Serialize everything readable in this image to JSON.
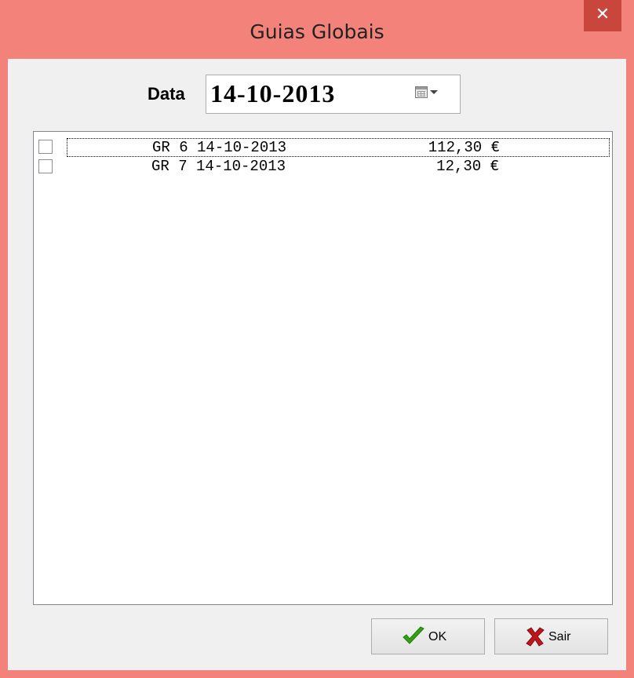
{
  "window": {
    "title": "Guias Globais",
    "close_glyph": "✕"
  },
  "date": {
    "label": "Data",
    "value": "14-10-2013",
    "picker_icon": "calendar-icon"
  },
  "list": {
    "items": [
      {
        "code": "GR 6 14-10-2013",
        "amount": "112,30 €",
        "checked": false,
        "focused": true
      },
      {
        "code": "GR 7 14-10-2013",
        "amount": "12,30 €",
        "checked": false,
        "focused": false
      }
    ]
  },
  "buttons": {
    "ok": "OK",
    "sair": "Sair"
  },
  "colors": {
    "title_bar": "#f3837a",
    "close_button": "#c9463d",
    "ok_check": "#35a014",
    "sair_x": "#c0161b"
  }
}
